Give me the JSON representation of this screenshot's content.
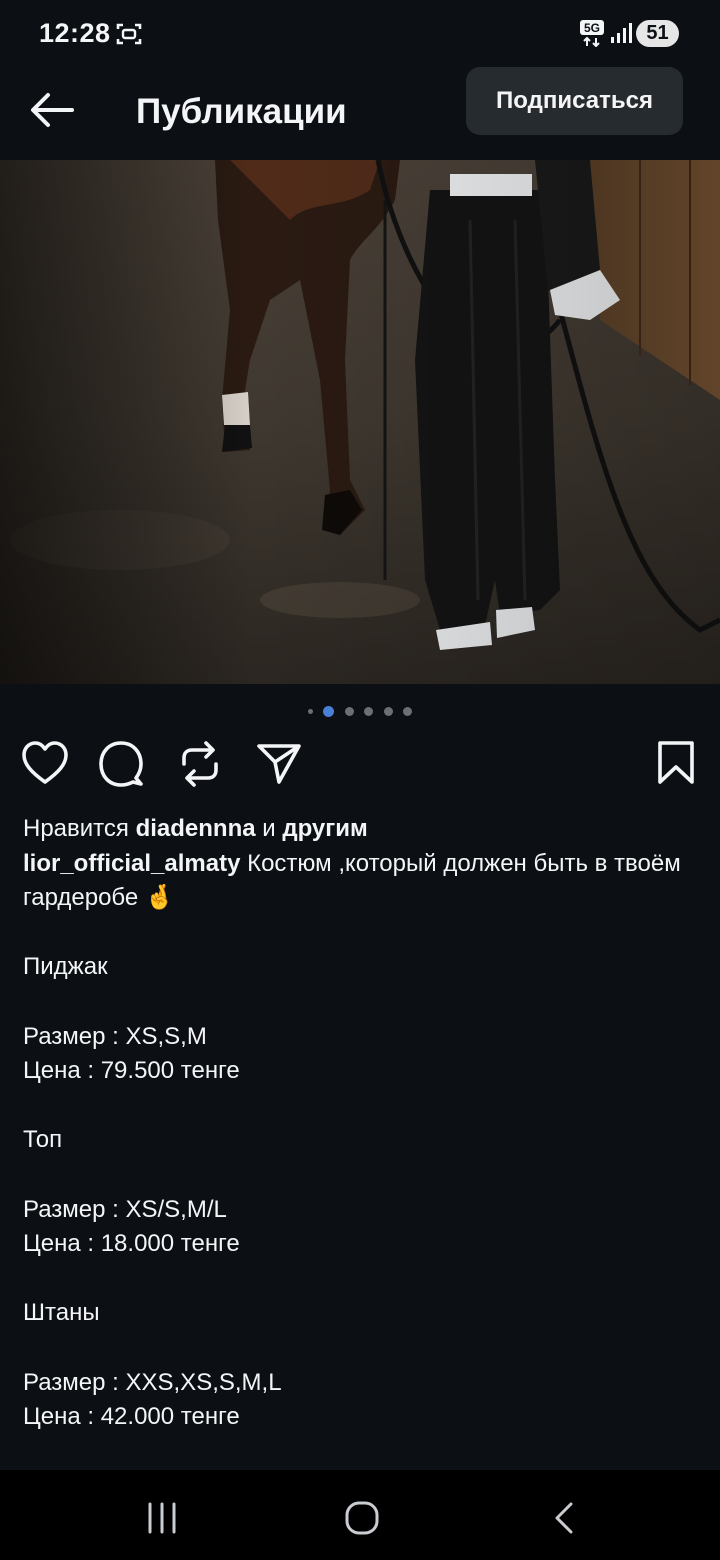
{
  "status_bar": {
    "time": "12:28",
    "network": "5G",
    "battery": "51"
  },
  "header": {
    "title": "Публикации",
    "follow_label": "Подписаться"
  },
  "carousel": {
    "total_dots": 6,
    "active_index": 1
  },
  "actions": [
    "heart-icon",
    "comment-icon",
    "repost-icon",
    "share-icon",
    "bookmark-icon"
  ],
  "likes": {
    "prefix": "Нравится",
    "user": "diadennna",
    "middle": "и",
    "others": "другим"
  },
  "caption": {
    "author": "lior_official_almaty",
    "text": "Костюм ,который должен быть в твоём гардеробе 🤞",
    "lines": [
      "Пиджак",
      "",
      "Размер : XS,S,M",
      "Цена : 79.500 тенге",
      "",
      "Топ",
      "",
      "Размер : XS/S,M/L",
      "Цена : 18.000 тенге",
      "",
      "Штаны",
      "",
      "Размер : XXS,XS,S,M,L",
      "Цена : 42.000 тенге"
    ]
  },
  "colors": {
    "background": "#0c0f14",
    "accent_dot": "#4a7fd8",
    "button_bg": "#262b30"
  }
}
